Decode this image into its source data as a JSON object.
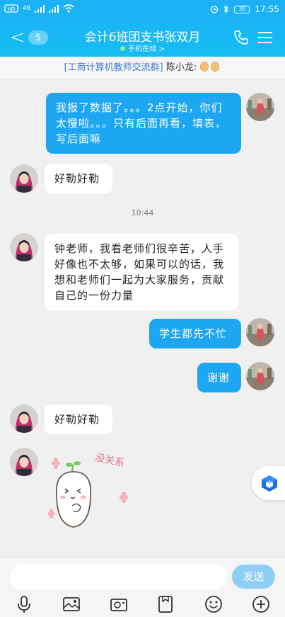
{
  "status": {
    "left_icons": [
      "sim-icon",
      "signal-icon",
      "signal-icon",
      "wifi-icon"
    ],
    "signal_label": "46",
    "battery": "30",
    "time": "17:55"
  },
  "header": {
    "back_glyph": "<",
    "unread_count": "5",
    "title": "会计6班团支书张双月",
    "subtitle": "手机在线 >"
  },
  "banner": {
    "group": "[工商计算机教师交流群]",
    "sender": "陈小龙:"
  },
  "messages": [
    {
      "dir": "out",
      "text": "我报了数据了。。。2点开始，你们太慢啦。。。只有后面再看，填表，写后面嘛"
    },
    {
      "dir": "in",
      "text": "好勒好勒"
    },
    {
      "dir": "in",
      "text": "钟老师，我看老师们很辛苦，人手好像也不太够，如果可以的话，我想和老师们一起为大家服务，贡献自己的一份力量"
    },
    {
      "dir": "out",
      "text": "学生都先不忙"
    },
    {
      "dir": "out",
      "text": "谢谢"
    },
    {
      "dir": "in",
      "text": "好勒好勒"
    }
  ],
  "time_divider": "10:44",
  "sticker_text": "没关系",
  "input": {
    "placeholder": "",
    "send_label": "发送"
  },
  "toolbar": [
    "microphone-icon",
    "image-icon",
    "camera-icon",
    "file-icon",
    "emoji-icon",
    "plus-icon"
  ],
  "colors": {
    "header": "#16b4f5",
    "out_bubble": "#1da7f2",
    "in_bubble": "#ffffff",
    "send_button": "#8ecdf4"
  }
}
